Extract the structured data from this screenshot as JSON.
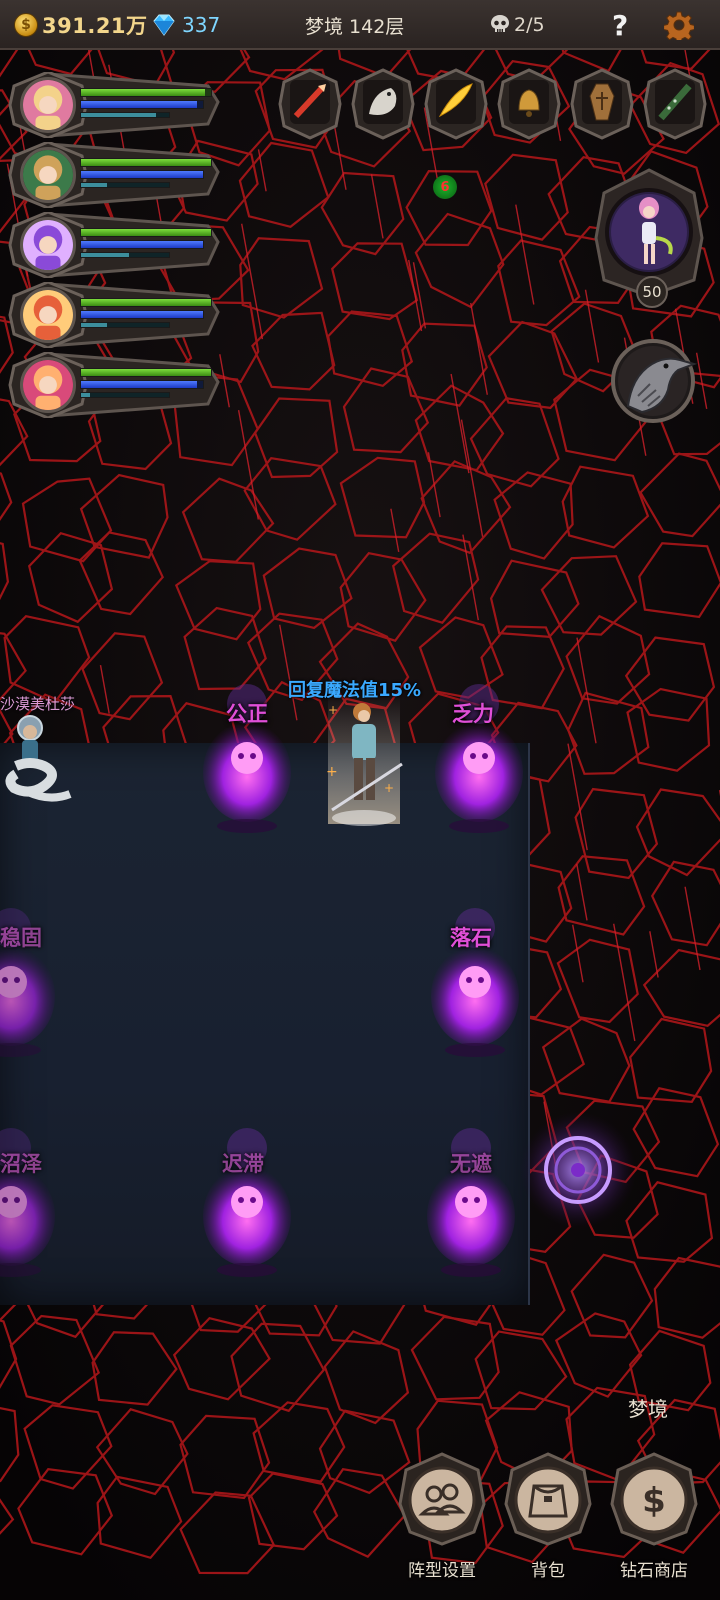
{
  "topbar": {
    "coin_icon": "coin-icon",
    "coins": "391.21万",
    "gem_icon": "diamond-icon",
    "gems": "337",
    "level": "梦境 142层",
    "skull_icon": "skull-icon",
    "kills": "2/5",
    "help_icon": "question-mark",
    "settings_icon": "gear-icon"
  },
  "heroes": [
    {
      "name": "hero-1",
      "hp": 0.95,
      "mp": 0.95,
      "xp": 0.85
    },
    {
      "name": "hero-2",
      "hp": 1.0,
      "mp": 1.0,
      "xp": 0.3
    },
    {
      "name": "hero-3",
      "hp": 1.0,
      "mp": 1.0,
      "xp": 0.55
    },
    {
      "name": "hero-4",
      "hp": 1.0,
      "mp": 1.0,
      "xp": 0.3
    },
    {
      "name": "hero-5",
      "hp": 1.0,
      "mp": 0.95,
      "xp": 0.1
    }
  ],
  "skills": [
    "spear-skill-icon",
    "griffin-skill-icon",
    "feather-skill-icon",
    "bell-skill-icon",
    "coffin-skill-icon",
    "flute-skill-icon"
  ],
  "buff_count": "6",
  "boss": {
    "level": "50",
    "icon": "catgirl-boss-avatar"
  },
  "battlefield": {
    "enemy_name": "沙漠美杜莎",
    "heal_text": "回复魔法值15%",
    "tiles": {
      "t1": "公正",
      "t2": "乏力",
      "t3": "稳固",
      "t4": "落石",
      "t5": "沼泽",
      "t6": "迟滞",
      "t7": "无遮"
    }
  },
  "bottom": {
    "dream_label": "梦境",
    "buttons": [
      {
        "label": "阵型设置",
        "icon": "formation-icon"
      },
      {
        "label": "背包",
        "icon": "backpack-icon"
      },
      {
        "label": "钻石商店",
        "icon": "dollar-icon"
      }
    ]
  },
  "colors": {
    "bg": "#0d0a0b",
    "lava_crack": "#c41a1a",
    "hp": "#6cc82e",
    "mp": "#2e5ce0",
    "tile_text": "#e04fd8",
    "heal_text": "#3aa9ff",
    "coin": "#f3d68c",
    "gem": "#7fd6ff"
  }
}
